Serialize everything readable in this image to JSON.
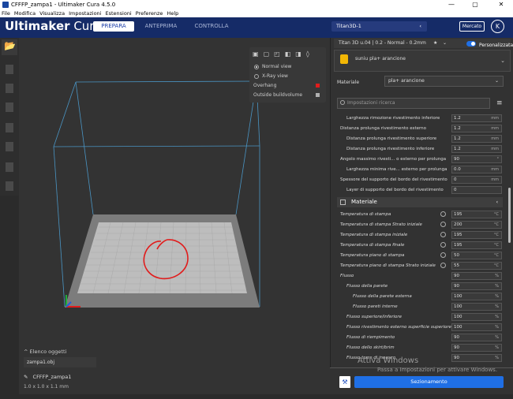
{
  "titlebar": {
    "title": "CFFFP_zampa1 - Ultimaker Cura 4.5.0",
    "minimize": "—",
    "maximize": "▢",
    "close": "✕"
  },
  "menubar": [
    "File",
    "Modifica",
    "Visualizza",
    "Impostazioni",
    "Estensioni",
    "Preferenze",
    "Help"
  ],
  "header": {
    "logo_bold": "Ultimaker",
    "logo_light": "Cura",
    "tabs": [
      {
        "label": "PREPARA",
        "active": true
      },
      {
        "label": "ANTEPRIMA",
        "active": false
      },
      {
        "label": "CONTROLLA",
        "active": false
      }
    ],
    "printer": "Titan3D-1",
    "marketplace": "Mercato",
    "account_initial": "K",
    "accent": "#152b67"
  },
  "view_panel": {
    "options": [
      {
        "label": "Normal view",
        "selected": true
      },
      {
        "label": "X-Ray view",
        "selected": false
      }
    ],
    "overhang": "Overhang",
    "overhang_color": "#e11c1c",
    "outside": "Outside buildvolume",
    "outside_color": "#b0b0b0"
  },
  "objects": {
    "header": "Elenco oggetti",
    "file": "zampa1.obj",
    "name": "CFFFP_zampa1",
    "dims": "1.0 x 1.0 x 1.1 mm"
  },
  "sidebar": {
    "profile": "Titan 3D u.04 | 0.2 - Normal - 0.2mm",
    "custom": "Personalizzata",
    "material_name": "suniu pla+ arancione",
    "material_label": "Materiale",
    "material_value": "pla+ arancione",
    "search_placeholder": "Impostazioni ricerca",
    "section_material": "Materiale",
    "slice": "Sezionamento"
  },
  "settings_top": [
    {
      "label": "Larghezza rimozione rivestimento inferiore",
      "value": "1.2",
      "unit": "mm",
      "indent": 1
    },
    {
      "label": "Distanza prolunga rivestimento esterno",
      "value": "1.2",
      "unit": "mm",
      "indent": 0
    },
    {
      "label": "Distanza prolunga rivestimento superiore",
      "value": "1.2",
      "unit": "mm",
      "indent": 1
    },
    {
      "label": "Distanza prolunga rivestimento inferiore",
      "value": "1.2",
      "unit": "mm",
      "indent": 1
    },
    {
      "label": "Angolo massimo rivesti... o esterno per prolunga",
      "value": "90",
      "unit": "°",
      "indent": 0
    },
    {
      "label": "Larghezza minima rive... esterno per prolunga",
      "value": "0.0",
      "unit": "mm",
      "indent": 1
    },
    {
      "label": "Spessore del supporto del bordo del rivestimento",
      "value": "0",
      "unit": "mm",
      "indent": 0
    },
    {
      "label": "Layer di supporto del bordo del rivestimento",
      "value": "0",
      "unit": "",
      "indent": 1
    }
  ],
  "settings_material": [
    {
      "label": "Temperatura di stampa",
      "value": "195",
      "unit": "°C",
      "indent": 0,
      "icon": true
    },
    {
      "label": "Temperatura di stampa Strato iniziale",
      "value": "200",
      "unit": "°C",
      "indent": 0,
      "icon": true
    },
    {
      "label": "Temperatura di stampa iniziale",
      "value": "195",
      "unit": "°C",
      "indent": 0,
      "icon": true
    },
    {
      "label": "Temperatura di stampa finale",
      "value": "195",
      "unit": "°C",
      "indent": 0,
      "icon": true
    },
    {
      "label": "Temperatura piano di stampa",
      "value": "50",
      "unit": "°C",
      "indent": 0,
      "icon": true
    },
    {
      "label": "Temperatura piano di stampa Strato iniziale",
      "value": "55",
      "unit": "°C",
      "indent": 0,
      "icon": true
    },
    {
      "label": "Flusso",
      "value": "90",
      "unit": "%",
      "indent": 0,
      "icon": false
    },
    {
      "label": "Flusso della parete",
      "value": "90",
      "unit": "%",
      "indent": 1,
      "icon": false
    },
    {
      "label": "Flusso della parete esterna",
      "value": "100",
      "unit": "%",
      "indent": 2,
      "icon": false
    },
    {
      "label": "Flusso pareti interne",
      "value": "100",
      "unit": "%",
      "indent": 2,
      "icon": false
    },
    {
      "label": "Flusso superiore/inferiore",
      "value": "100",
      "unit": "%",
      "indent": 1,
      "icon": false
    },
    {
      "label": "Flusso rivestimento esterno superficie superiore",
      "value": "100",
      "unit": "%",
      "indent": 1,
      "icon": false
    },
    {
      "label": "Flusso di riempimento",
      "value": "90",
      "unit": "%",
      "indent": 1,
      "icon": false
    },
    {
      "label": "Flusso dello skirt/brim",
      "value": "90",
      "unit": "%",
      "indent": 1,
      "icon": false
    },
    {
      "label": "Flusso torre di innesco",
      "value": "90",
      "unit": "%",
      "indent": 1,
      "icon": false
    }
  ],
  "watermark": {
    "line1": "Attiva Windows",
    "line2": "Passa a Impostazioni per attivare Windows."
  }
}
